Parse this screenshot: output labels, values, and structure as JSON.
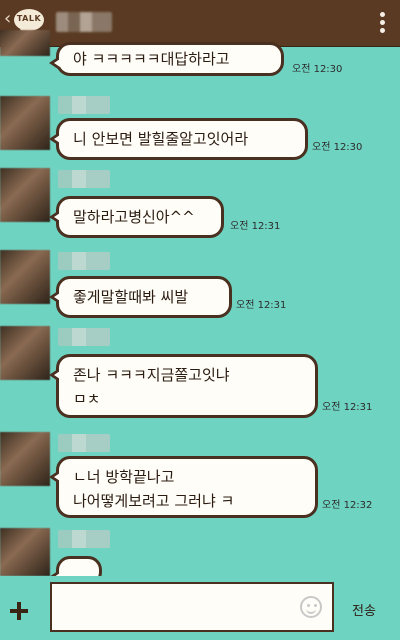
{
  "header": {
    "logo_text": "TALK",
    "back_icon": "chevron-left-icon",
    "menu_icon": "vertical-dots-icon"
  },
  "messages": [
    {
      "text": "야 ㅋㅋㅋㅋㅋ대답하라고",
      "time": "오전 12:30"
    },
    {
      "text": "니 안보면 발힐줄알고잇어라",
      "time": "오전 12:30"
    },
    {
      "text": "말하라고병신아^^",
      "time": "오전 12:31"
    },
    {
      "text": "좋게말할때봐 씨발",
      "time": "오전 12:31"
    },
    {
      "text": "존나 ㅋㅋㅋ지금쫄고잇냐\nㅁㅊ",
      "time": "오전 12:31"
    },
    {
      "text": "ㄴ너 방학끝나고\n나어떻게보려고 그러냐 ㅋ",
      "time": "오전 12:32"
    }
  ],
  "composer": {
    "input_value": "",
    "send_label": "전송",
    "plus_icon": "plus-icon",
    "emoji_icon": "emoticon-icon"
  },
  "colors": {
    "background": "#6fd3c2",
    "header": "#5a3a22",
    "bubble": "#fffdf7",
    "bubble_border": "#4a3020"
  }
}
